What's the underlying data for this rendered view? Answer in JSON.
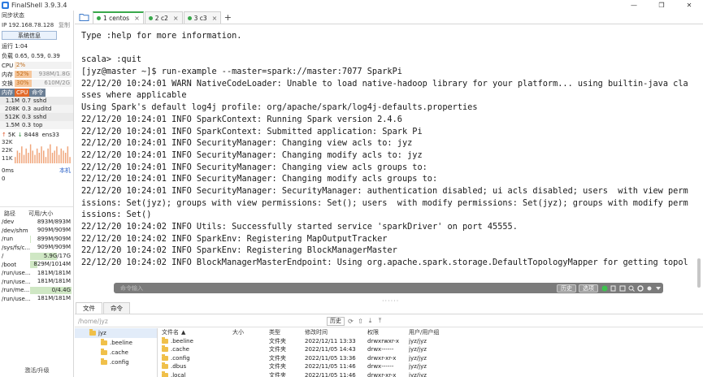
{
  "window": {
    "title": "FinalShell 3.9.3.4",
    "buttons": [
      "—",
      "❒",
      "✕"
    ]
  },
  "sidebar": {
    "sync_status": "同步状态",
    "ip_label": "IP 192.168.78.128",
    "copy": "复制",
    "sysinfo_button": "系统信息",
    "uptime": "运行 1:04",
    "load": "负载 0.65, 0.59, 0.39",
    "cpu": {
      "label": "CPU",
      "percent": "2%",
      "fraction": 0.02
    },
    "mem": {
      "label": "内存",
      "percent": "52%",
      "value": "938M/1.8G",
      "fraction": 0.52
    },
    "swap": {
      "label": "交换",
      "percent": "30%",
      "value": "610M/2G",
      "fraction": 0.3
    },
    "proc_tabs": [
      "内存",
      "CPU",
      "命令"
    ],
    "processes": [
      {
        "mem": "1.1M",
        "cpu": "0.7",
        "cmd": "sshd"
      },
      {
        "mem": "208K",
        "cpu": "0.3",
        "cmd": "auditd"
      },
      {
        "mem": "512K",
        "cpu": "0.3",
        "cmd": "sshd"
      },
      {
        "mem": "1.5M",
        "cpu": "0.3",
        "cmd": "top"
      }
    ],
    "net": {
      "up": "5K",
      "down": "8448",
      "iface": "ens33",
      "yticks": [
        "32K",
        "22K",
        "11K"
      ],
      "bars": [
        0.3,
        0.6,
        0.5,
        0.8,
        0.4,
        0.7,
        0.5,
        0.9,
        0.6,
        0.4,
        0.7,
        0.5,
        0.8,
        0.6,
        0.3,
        0.7,
        0.9,
        0.5,
        0.6,
        0.8,
        0.4,
        0.7,
        0.6,
        0.5,
        0.8,
        0.3
      ]
    },
    "latency": {
      "zero": "0ms",
      "local": "本机",
      "zero2": "0"
    },
    "disk_headers": [
      "路径",
      "可用/大小"
    ],
    "disks": [
      {
        "path": "/dev",
        "value": "893M/893M",
        "fraction": 0.0
      },
      {
        "path": "/dev/shm",
        "value": "909M/909M",
        "fraction": 0.0
      },
      {
        "path": "/run",
        "value": "899M/909M",
        "fraction": 0.01
      },
      {
        "path": "/sys/fs/c...",
        "value": "909M/909M",
        "fraction": 0.0
      },
      {
        "path": "/",
        "value": "5.9G/17G",
        "fraction": 0.65
      },
      {
        "path": "/boot",
        "value": "829M/1014M",
        "fraction": 0.18
      },
      {
        "path": "/run/use...",
        "value": "181M/181M",
        "fraction": 0.0
      },
      {
        "path": "/run/use...",
        "value": "181M/181M",
        "fraction": 0.0
      },
      {
        "path": "/run/me...",
        "value": "0/4.4G",
        "fraction": 1.0
      },
      {
        "path": "/run/use...",
        "value": "181M/181M",
        "fraction": 0.0
      }
    ],
    "upgrade": "激活/升级"
  },
  "tabs": [
    {
      "label": "1 centos",
      "active": true
    },
    {
      "label": "2 c2",
      "active": false
    },
    {
      "label": "3 c3",
      "active": false
    }
  ],
  "terminal": {
    "lines": [
      "Type :help for more information.",
      "",
      "scala> :quit",
      "[jyz@master ~]$ run-example --master=spark://master:7077 SparkPi",
      "22/12/20 10:24:01 WARN NativeCodeLoader: Unable to load native-hadoop library for your platform... using builtin-java cla",
      "sses where applicable",
      "Using Spark's default log4j profile: org/apache/spark/log4j-defaults.properties",
      "22/12/20 10:24:01 INFO SparkContext: Running Spark version 2.4.6",
      "22/12/20 10:24:01 INFO SparkContext: Submitted application: Spark Pi",
      "22/12/20 10:24:01 INFO SecurityManager: Changing view acls to: jyz",
      "22/12/20 10:24:01 INFO SecurityManager: Changing modify acls to: jyz",
      "22/12/20 10:24:01 INFO SecurityManager: Changing view acls groups to:",
      "22/12/20 10:24:01 INFO SecurityManager: Changing modify acls groups to:",
      "22/12/20 10:24:01 INFO SecurityManager: SecurityManager: authentication disabled; ui acls disabled; users  with view perm",
      "issions: Set(jyz); groups with view permissions: Set(); users  with modify permissions: Set(jyz); groups with modify perm",
      "issions: Set()",
      "22/12/20 10:24:02 INFO Utils: Successfully started service 'sparkDriver' on port 45555.",
      "22/12/20 10:24:02 INFO SparkEnv: Registering MapOutputTracker",
      "22/12/20 10:24:02 INFO SparkEnv: Registering BlockManagerMaster",
      "22/12/20 10:24:02 INFO BlockManagerMasterEndpoint: Using org.apache.spark.storage.DefaultTopologyMapper for getting topol"
    ]
  },
  "cmdbar": {
    "placeholder": "命令输入",
    "history": "历史",
    "options": "选项"
  },
  "bottom_tabs": [
    "文件",
    "命令"
  ],
  "filebar": {
    "path": "/home/jyz",
    "history": "历史"
  },
  "tree": [
    {
      "label": "jyz",
      "selected": true
    },
    {
      "label": ".beeline"
    },
    {
      "label": ".cache"
    },
    {
      "label": ".config"
    }
  ],
  "file_headers": [
    "文件名",
    "大小",
    "类型",
    "修改时间",
    "权限",
    "用户/用户组"
  ],
  "files": [
    {
      "name": ".beeline",
      "type": "文件夹",
      "mtime": "2022/12/11 13:33",
      "perm": "drwxrwxr-x",
      "owner": "jyz/jyz"
    },
    {
      "name": ".cache",
      "type": "文件夹",
      "mtime": "2022/11/05 14:43",
      "perm": "drwx------",
      "owner": "jyz/jyz"
    },
    {
      "name": ".config",
      "type": "文件夹",
      "mtime": "2022/11/05 13:36",
      "perm": "drwxr-xr-x",
      "owner": "jyz/jyz"
    },
    {
      "name": ".dbus",
      "type": "文件夹",
      "mtime": "2022/11/05 11:46",
      "perm": "drwx------",
      "owner": "jyz/jyz"
    },
    {
      "name": ".local",
      "type": "文件夹",
      "mtime": "2022/11/05 11:46",
      "perm": "drwxr-xr-x",
      "owner": "jyz/jyz"
    }
  ]
}
